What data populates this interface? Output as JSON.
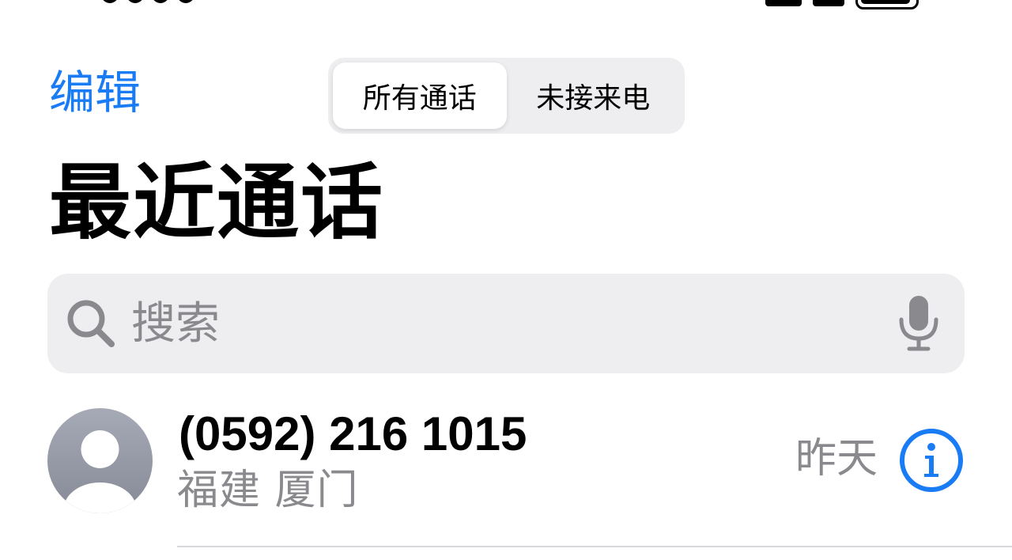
{
  "colors": {
    "accent": "#1a7cf5",
    "secondary_text": "#8a8a8e",
    "search_background": "#eeeef0"
  },
  "nav": {
    "edit_label": "编辑",
    "segments": [
      {
        "label": "所有通话",
        "selected": true
      },
      {
        "label": "未接来电",
        "selected": false
      }
    ]
  },
  "title": "最近通话",
  "search": {
    "placeholder": "搜索",
    "icon": "search-icon",
    "mic_icon": "mic-icon"
  },
  "calls": [
    {
      "number": "(0592) 216 1015",
      "location": "福建 厦门",
      "date": "昨天",
      "avatar_icon": "person-icon",
      "info_icon": "info-icon"
    }
  ]
}
